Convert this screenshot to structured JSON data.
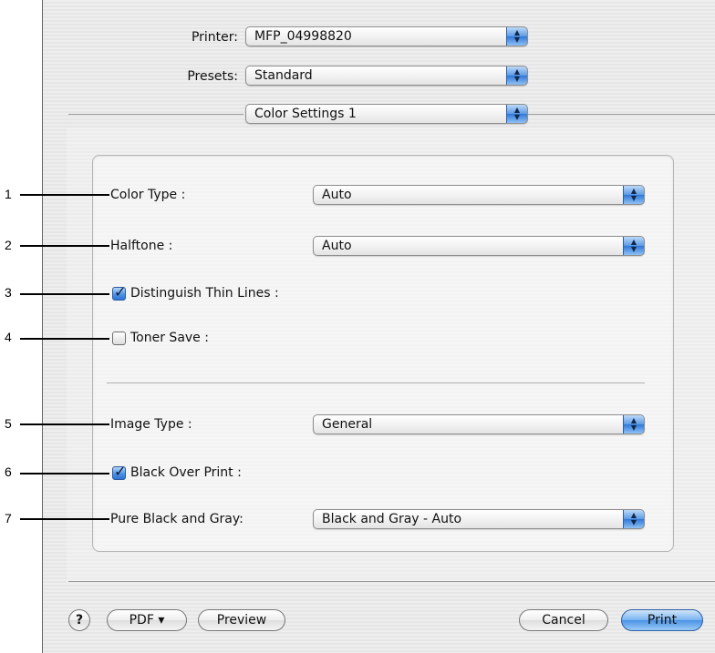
{
  "header": {
    "printer_label": "Printer:",
    "printer_value": "MFP_04998820",
    "presets_label": "Presets:",
    "presets_value": "Standard",
    "panel_value": "Color Settings 1"
  },
  "settings": {
    "color_type_label": "Color Type :",
    "color_type_value": "Auto",
    "halftone_label": "Halftone :",
    "halftone_value": "Auto",
    "distinguish_label": "Distinguish Thin Lines :",
    "distinguish_checked": true,
    "toner_save_label": "Toner Save :",
    "toner_save_checked": false,
    "image_type_label": "Image Type :",
    "image_type_value": "General",
    "black_over_print_label": "Black Over Print :",
    "black_over_print_checked": true,
    "pure_black_label": "Pure Black and Gray:",
    "pure_black_value": "Black and Gray - Auto"
  },
  "callouts": [
    "1",
    "2",
    "3",
    "4",
    "5",
    "6",
    "7"
  ],
  "footer": {
    "help_label": "?",
    "pdf_label": "PDF ▾",
    "preview_label": "Preview",
    "cancel_label": "Cancel",
    "print_label": "Print"
  },
  "icons": {
    "popup_arrows": "updown-arrows-icon",
    "checkmark": "checkmark-icon",
    "help": "question-mark-icon"
  },
  "colors": {
    "accent": "#4a92e6",
    "dialog_bg": "#ececec",
    "callout_line": "#000000"
  }
}
